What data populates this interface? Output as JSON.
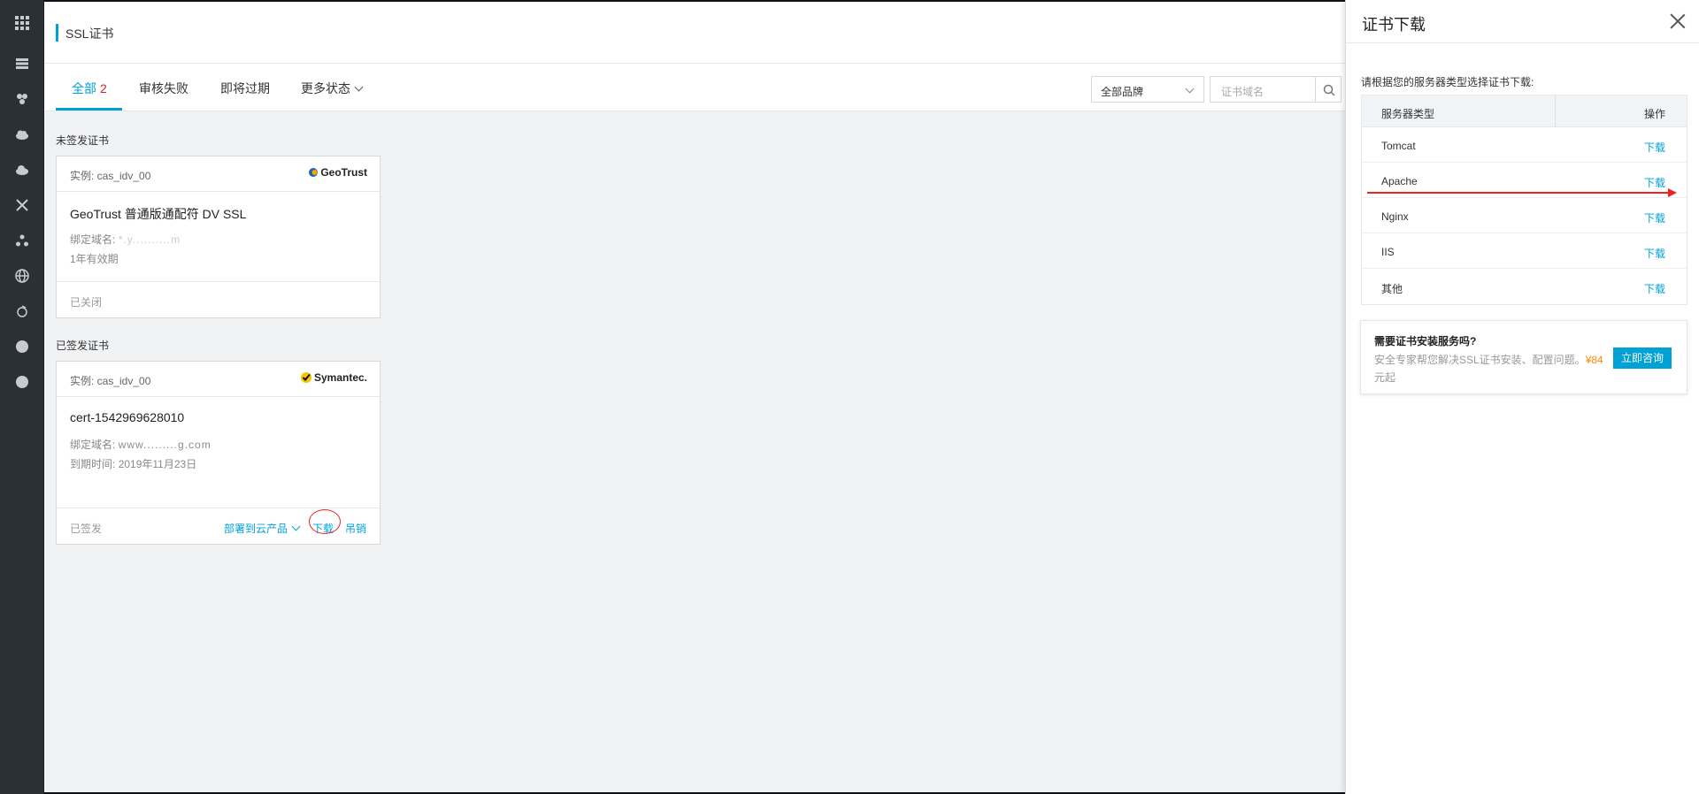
{
  "page": {
    "title": "SSL证书"
  },
  "tabs": [
    {
      "label": "全部",
      "count": "2"
    },
    {
      "label": "审核失败"
    },
    {
      "label": "即将过期"
    },
    {
      "label": "更多状态"
    }
  ],
  "filters": {
    "brand_select": "全部品牌",
    "search_placeholder": "证书域名"
  },
  "sections": {
    "unissued": "未签发证书",
    "issued": "已签发证书"
  },
  "cards": [
    {
      "instance": "实例: cas_idv_00",
      "brand": "GeoTrust",
      "name": "GeoTrust 普通版通配符 DV SSL",
      "domain_label": "绑定域名:",
      "domain_value": "*.y..........m",
      "validity": "1年有效期",
      "status": "已关闭"
    },
    {
      "instance": "实例: cas_idv_00",
      "brand": "Symantec.",
      "name": "cert-1542969628010",
      "domain_label": "绑定域名:",
      "domain_value": "www.........g.com",
      "expire_label": "到期时间:",
      "expire_value": "2019年11月23日",
      "status": "已签发",
      "actions": {
        "deploy": "部署到云产品",
        "download": "下载",
        "revoke": "吊销"
      }
    }
  ],
  "drawer": {
    "title": "证书下载",
    "description": "请根据您的服务器类型选择证书下载:",
    "table": {
      "col_server": "服务器类型",
      "col_action": "操作",
      "rows": [
        {
          "server": "Tomcat",
          "action": "下载"
        },
        {
          "server": "Apache",
          "action": "下载"
        },
        {
          "server": "Nginx",
          "action": "下载"
        },
        {
          "server": "IIS",
          "action": "下载"
        },
        {
          "server": "其他",
          "action": "下载"
        }
      ]
    },
    "promo": {
      "title": "需要证书安装服务吗?",
      "text": "安全专家帮您解决SSL证书安装、配置问题。",
      "price": "¥84",
      "unit": "元起",
      "button": "立即咨询"
    }
  },
  "colors": {
    "accent": "#00a1d6",
    "annotation": "#e22222",
    "price": "#ff8a00"
  },
  "icons": [
    "apps-grid-icon",
    "server-icon",
    "nodes-icon",
    "cloud-icon",
    "cloud-upload-icon",
    "network-icon",
    "cluster-icon",
    "globe-icon",
    "shield-icon",
    "dot-icon",
    "dot-icon"
  ]
}
